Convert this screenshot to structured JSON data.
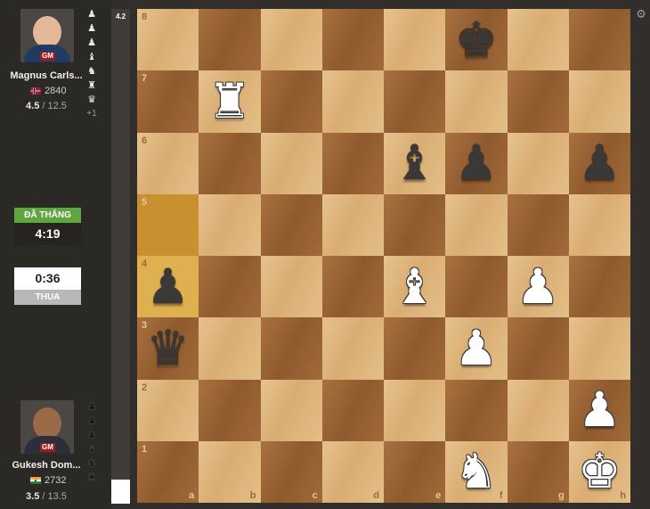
{
  "top_player": {
    "title_badge": "GM",
    "name": "Magnus Carls...",
    "rating": "2840",
    "score": "4.5",
    "score_total": "/ 12.5",
    "flag": "norway",
    "captured": [
      "♟",
      "♟",
      "♟",
      "♝",
      "♞",
      "♜",
      "♛"
    ],
    "captured_extra": "+1"
  },
  "bottom_player": {
    "title_badge": "GM",
    "name": "Gukesh Dom...",
    "rating": "2732",
    "score": "3.5",
    "score_total": "/ 13.5",
    "flag": "india",
    "captured": [
      "♟",
      "♟",
      "♟",
      "♝",
      "♞",
      "♜"
    ]
  },
  "top_clock": {
    "result": "ĐÃ THẮNG",
    "time": "4:19",
    "color": "#5ea73e"
  },
  "bottom_clock": {
    "time": "0:36",
    "result": "THUA",
    "color": "#b8b8b8"
  },
  "eval_bar": {
    "score": "4.2"
  },
  "board": {
    "files": [
      "a",
      "b",
      "c",
      "d",
      "e",
      "f",
      "g",
      "h"
    ],
    "ranks": [
      "8",
      "7",
      "6",
      "5",
      "4",
      "3",
      "2",
      "1"
    ],
    "highlighted": [
      "a5",
      "a4"
    ],
    "pieces": [
      {
        "square": "f8",
        "piece": "♚",
        "color": "b",
        "name": "black-king"
      },
      {
        "square": "b7",
        "piece": "♜",
        "color": "w",
        "name": "white-rook"
      },
      {
        "square": "e6",
        "piece": "♝",
        "color": "b",
        "name": "black-bishop"
      },
      {
        "square": "f6",
        "piece": "♟",
        "color": "b",
        "name": "black-pawn"
      },
      {
        "square": "h6",
        "piece": "♟",
        "color": "b",
        "name": "black-pawn"
      },
      {
        "square": "a4",
        "piece": "♟",
        "color": "b",
        "name": "black-pawn"
      },
      {
        "square": "e4",
        "piece": "♝",
        "color": "w",
        "name": "white-bishop"
      },
      {
        "square": "g4",
        "piece": "♟",
        "color": "w",
        "name": "white-pawn"
      },
      {
        "square": "a3",
        "piece": "♛",
        "color": "b",
        "name": "black-queen"
      },
      {
        "square": "f3",
        "piece": "♟",
        "color": "w",
        "name": "white-pawn"
      },
      {
        "square": "h2",
        "piece": "♟",
        "color": "w",
        "name": "white-pawn"
      },
      {
        "square": "f1",
        "piece": "♞",
        "color": "w",
        "name": "white-knight"
      },
      {
        "square": "h1",
        "piece": "♚",
        "color": "w",
        "name": "white-king"
      }
    ]
  },
  "icons": {
    "settings": "gear-icon"
  }
}
